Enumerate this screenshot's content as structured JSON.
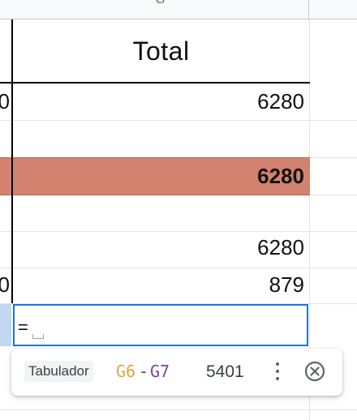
{
  "column_header": {
    "letter": "G"
  },
  "header_cell": {
    "label": "Total"
  },
  "rows": [
    {
      "left_fragment": "0",
      "value": "6280"
    },
    {
      "value": "6280",
      "bold": true
    },
    {
      "value": "6280"
    },
    {
      "left_fragment": "0",
      "value": "879"
    }
  ],
  "selected_cell": {
    "formula": "="
  },
  "suggestion": {
    "chip_label": "Tabulador",
    "ref_start": "G6",
    "ref_separator": "-",
    "ref_end": "G7",
    "result": "5401",
    "ref_start_color": "#e8a33d",
    "ref_end_color": "#7b3f9e",
    "more_icon": "more-vert-icon",
    "close_icon": "close-circle-icon"
  },
  "colors": {
    "highlight_row": "#d3826f",
    "selection_border": "#1a73e8"
  }
}
